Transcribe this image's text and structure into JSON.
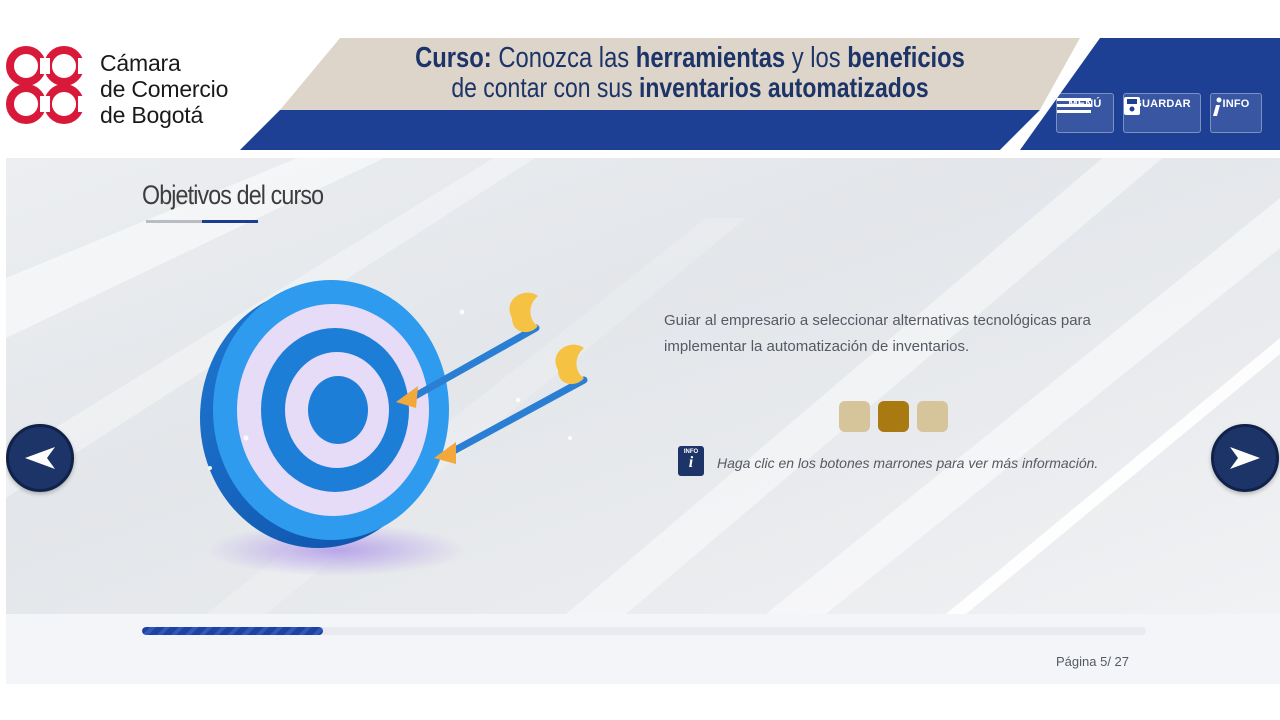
{
  "header": {
    "logo_lines": [
      "Cámara",
      "de Comercio",
      "de Bogotá"
    ],
    "title_line1": {
      "prefix": "Curso:",
      "parts": [
        " Conozca las ",
        "herramientas",
        " y los ",
        "beneficios"
      ]
    },
    "title_line2": {
      "parts": [
        "de contar con sus ",
        "inventarios automatizados"
      ]
    },
    "buttons": {
      "menu": "MENÚ",
      "save": "GUARDAR",
      "info": "INFO"
    },
    "colors": {
      "brand_red": "#d8193a",
      "navy": "#1c3467",
      "banner_blue": "#1d3f94",
      "banner_beige": "#ddd5ca"
    }
  },
  "main": {
    "section_title": "Objetivos del curso",
    "objective": "Guiar al empresario a seleccionar alternativas tecnológicas para implementar la automatización de inventarios.",
    "option_buttons": [
      {
        "label": "",
        "state": "inactive",
        "color": "#d6c49b"
      },
      {
        "label": "",
        "state": "active",
        "color": "#a97a12"
      },
      {
        "label": "",
        "state": "inactive",
        "color": "#d6c49b"
      }
    ],
    "info_icon_label": "INFO",
    "info_icon_glyph": "i",
    "hint": "Haga clic en los botones marrones para ver más información.",
    "illustration": "target-with-arrows-icon"
  },
  "navigation": {
    "prev_icon": "arrow-left-icon",
    "next_icon": "arrow-right-icon"
  },
  "footer": {
    "progress_fraction": 0.18,
    "page_text": "Página 5/ 27",
    "current_page": 5,
    "total_pages": 27
  }
}
